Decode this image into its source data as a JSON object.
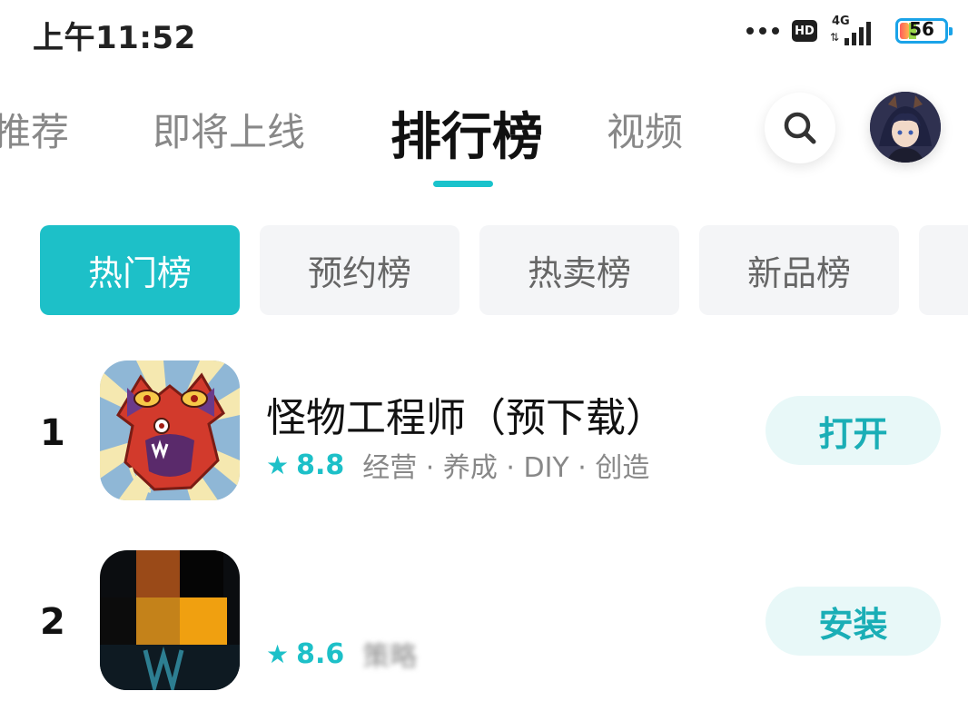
{
  "status_bar": {
    "time": "上午11:52",
    "hd_label": "HD",
    "network": "4G",
    "battery": "56",
    "icons": [
      "more-dots-icon",
      "hd-icon",
      "signal-icon",
      "battery-icon"
    ]
  },
  "nav": {
    "tabs": [
      "推荐",
      "即将上线",
      "排行榜",
      "视频"
    ],
    "active_tab": "排行榜",
    "accent_color": "#1dc0c8"
  },
  "categories": {
    "items": [
      "热门榜",
      "预约榜",
      "热卖榜",
      "新品榜"
    ],
    "active": "热门榜"
  },
  "apps": [
    {
      "rank": "1",
      "title": "怪物工程师（预下载）",
      "score": "8.8",
      "tags": "经营 · 养成 · DIY · 创造",
      "action": "打开"
    },
    {
      "rank": "2",
      "title": "",
      "score": "8.6",
      "tags": "策略",
      "action": "安装"
    }
  ]
}
